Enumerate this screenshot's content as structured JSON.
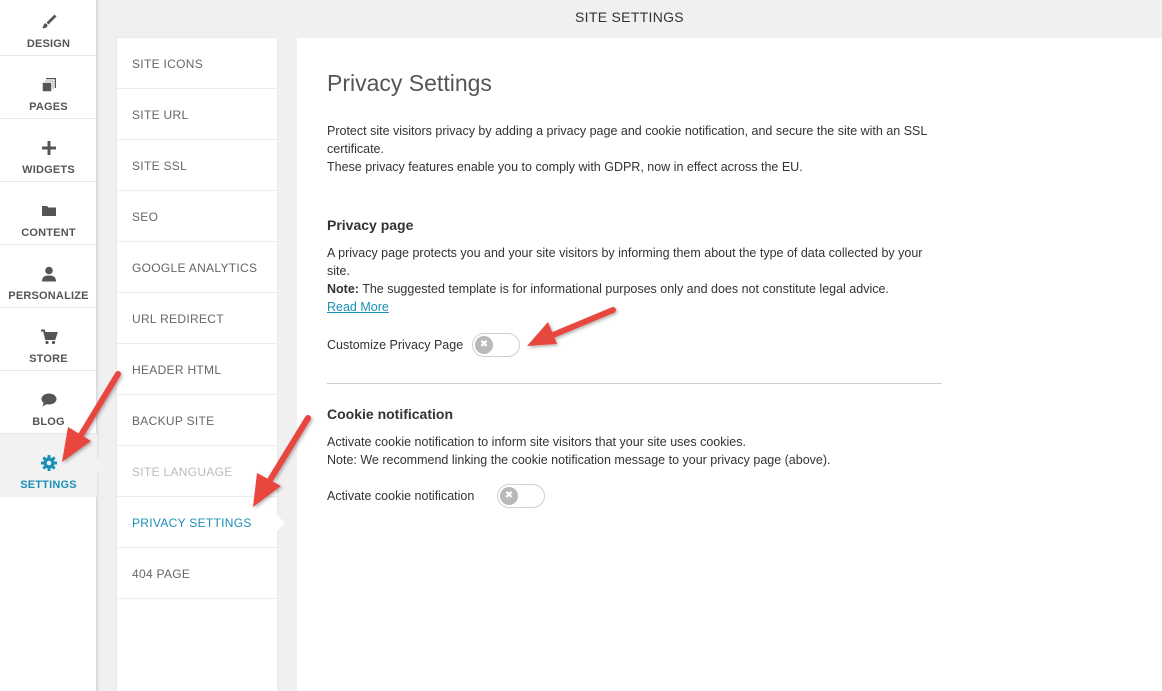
{
  "app_nav": {
    "items": [
      {
        "label": "DESIGN",
        "icon": "paintbrush-icon"
      },
      {
        "label": "PAGES",
        "icon": "pages-icon"
      },
      {
        "label": "WIDGETS",
        "icon": "plus-icon"
      },
      {
        "label": "CONTENT",
        "icon": "folder-icon"
      },
      {
        "label": "PERSONALIZE",
        "icon": "person-icon"
      },
      {
        "label": "STORE",
        "icon": "cart-icon"
      },
      {
        "label": "BLOG",
        "icon": "chat-bubble-icon"
      },
      {
        "label": "SETTINGS",
        "icon": "gear-icon",
        "active": true
      }
    ]
  },
  "header": {
    "title": "SITE SETTINGS"
  },
  "settings_menu": {
    "items": [
      {
        "label": "SITE ICONS"
      },
      {
        "label": "SITE URL"
      },
      {
        "label": "SITE SSL"
      },
      {
        "label": "SEO"
      },
      {
        "label": "GOOGLE ANALYTICS"
      },
      {
        "label": "URL REDIRECT"
      },
      {
        "label": "HEADER HTML"
      },
      {
        "label": "BACKUP SITE"
      },
      {
        "label": "SITE LANGUAGE",
        "disabled": true
      },
      {
        "label": "PRIVACY SETTINGS",
        "active": true
      },
      {
        "label": "404 PAGE"
      }
    ]
  },
  "privacy": {
    "title": "Privacy Settings",
    "intro_line1": "Protect site visitors privacy by adding a privacy page and cookie notification, and secure the site with an SSL certificate.",
    "intro_line2": "These privacy features enable you to comply with GDPR, now in effect across the EU.",
    "privacy_page": {
      "heading": "Privacy page",
      "description": "A privacy page protects you and your site visitors by informing them about the type of data collected by your site.",
      "note_label": "Note:",
      "note_text": " The suggested template is for informational purposes only and does not constitute legal advice.",
      "read_more": "Read More",
      "toggle_label": "Customize Privacy Page",
      "toggle_on": false
    },
    "cookie": {
      "heading": "Cookie notification",
      "description": "Activate cookie notification to inform site visitors that your site uses cookies.",
      "note": "Note: We recommend linking the cookie notification message to your privacy page (above).",
      "toggle_label": "Activate cookie notification",
      "toggle_on": false
    }
  },
  "colors": {
    "accent": "#1a8fb7",
    "annotation_arrow": "#e8473f"
  },
  "toggle_off_glyph": "✖"
}
